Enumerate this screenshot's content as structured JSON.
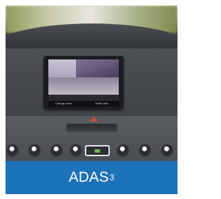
{
  "photo": {
    "screen_softkeys": [
      "Change View",
      "Wide View"
    ]
  },
  "caption": {
    "text": "ADAS",
    "superscript": "3",
    "background": "#1d73b8",
    "color": "#ffffff"
  }
}
